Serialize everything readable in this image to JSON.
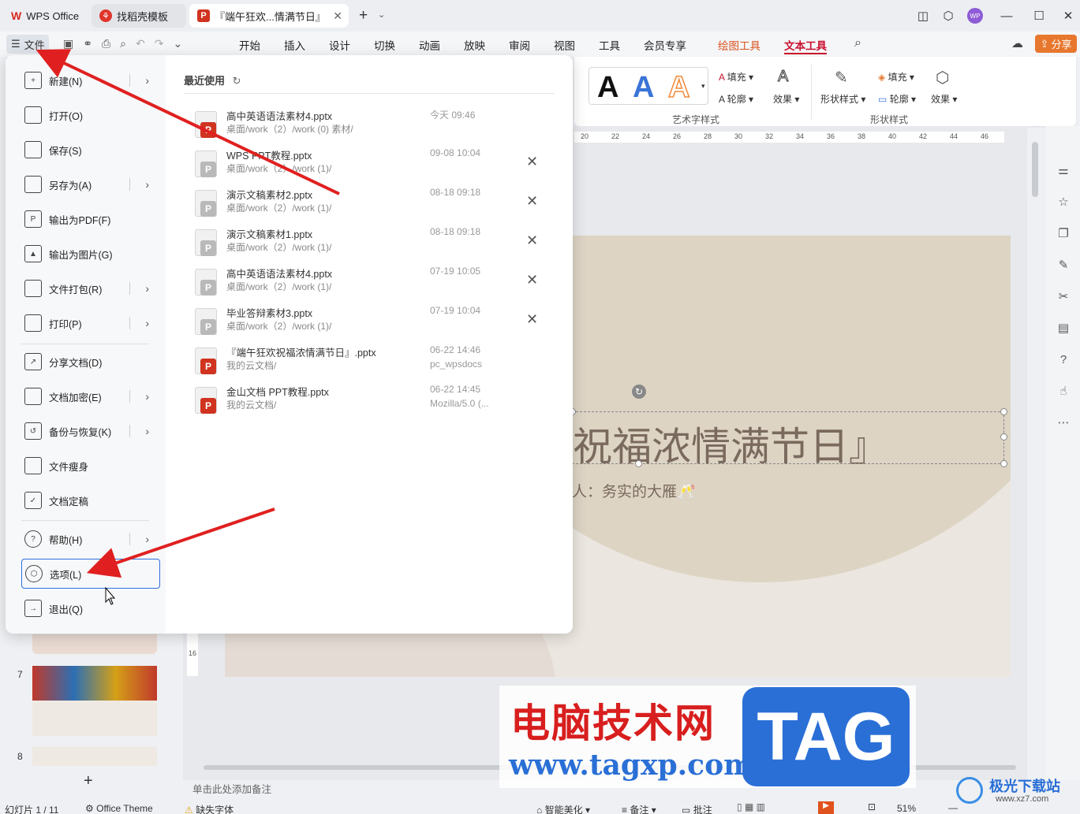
{
  "titlebar": {
    "tabs": [
      {
        "label": "WPS Office",
        "icon": "wps-logo-icon"
      },
      {
        "label": "找稻壳模板",
        "icon": "docer-icon"
      },
      {
        "label": "『端午狂欢...情满节日』",
        "icon": "ppt-icon"
      }
    ],
    "add_tab": "+",
    "avatar": "WP"
  },
  "menubar": {
    "file_label": "文件",
    "tabs": [
      "开始",
      "插入",
      "设计",
      "切换",
      "动画",
      "放映",
      "审阅",
      "视图",
      "工具",
      "会员专享",
      "绘图工具",
      "文本工具"
    ],
    "share_label": "分享"
  },
  "ribbon": {
    "fill": "填充",
    "outline": "轮廓",
    "effect": "效果",
    "shape_style": "形状样式",
    "art_group": "艺术字样式",
    "shape_group": "形状样式",
    "art_letters": [
      "A",
      "A",
      "A"
    ],
    "ruler": [
      "20",
      "22",
      "24",
      "26",
      "28",
      "30",
      "32",
      "34",
      "36",
      "38",
      "40",
      "42",
      "44",
      "46"
    ]
  },
  "file_menu": {
    "items": [
      {
        "label": "新建(N)",
        "icon": "new-file-icon",
        "arrow": true
      },
      {
        "label": "打开(O)",
        "icon": "open-folder-icon",
        "arrow": false
      },
      {
        "label": "保存(S)",
        "icon": "save-icon",
        "arrow": false
      },
      {
        "label": "另存为(A)",
        "icon": "save-as-icon",
        "arrow": true
      },
      {
        "label": "输出为PDF(F)",
        "icon": "pdf-icon",
        "arrow": false
      },
      {
        "label": "输出为图片(G)",
        "icon": "image-icon",
        "arrow": false
      },
      {
        "label": "文件打包(R)",
        "icon": "package-icon",
        "arrow": true
      },
      {
        "label": "打印(P)",
        "icon": "print-icon",
        "arrow": true
      },
      {
        "label": "分享文档(D)",
        "icon": "share-icon",
        "arrow": false
      },
      {
        "label": "文档加密(E)",
        "icon": "lock-icon",
        "arrow": true
      },
      {
        "label": "备份与恢复(K)",
        "icon": "backup-icon",
        "arrow": true
      },
      {
        "label": "文件瘦身",
        "icon": "slim-icon",
        "arrow": false
      },
      {
        "label": "文档定稿",
        "icon": "finalize-icon",
        "arrow": false
      },
      {
        "label": "帮助(H)",
        "icon": "help-icon",
        "arrow": true
      },
      {
        "label": "选项(L)",
        "icon": "settings-hex-icon",
        "arrow": false
      },
      {
        "label": "退出(Q)",
        "icon": "exit-icon",
        "arrow": false
      }
    ],
    "recent_title": "最近使用",
    "recent": [
      {
        "name": "高中英语语法素材4.pptx",
        "path": "桌面/work（2）/work (0) 素材/",
        "time": "今天  09:46",
        "time2": "",
        "closable": false,
        "cloud": false,
        "active": true
      },
      {
        "name": "WPS PPT教程.pptx",
        "path": "桌面/work（2）/work (1)/",
        "time": "09-08 10:04",
        "time2": "",
        "closable": true,
        "cloud": false,
        "active": false
      },
      {
        "name": "演示文稿素材2.pptx",
        "path": "桌面/work（2）/work (1)/",
        "time": "08-18 09:18",
        "time2": "",
        "closable": true,
        "cloud": false,
        "active": false
      },
      {
        "name": "演示文稿素材1.pptx",
        "path": "桌面/work（2）/work (1)/",
        "time": "08-18 09:18",
        "time2": "",
        "closable": true,
        "cloud": false,
        "active": false
      },
      {
        "name": "高中英语语法素材4.pptx",
        "path": "桌面/work（2）/work (1)/",
        "time": "07-19 10:05",
        "time2": "",
        "closable": true,
        "cloud": false,
        "active": false
      },
      {
        "name": "毕业答辩素材3.pptx",
        "path": "桌面/work（2）/work (1)/",
        "time": "07-19 10:04",
        "time2": "",
        "closable": true,
        "cloud": false,
        "active": false
      },
      {
        "name": "『端午狂欢祝福浓情满节日』.pptx",
        "path": "我的云文档/",
        "time": "06-22 14:46",
        "time2": "pc_wpsdocs",
        "closable": false,
        "cloud": true,
        "active": true
      },
      {
        "name": "金山文档 PPT教程.pptx",
        "path": "我的云文档/",
        "time": "06-22 14:45",
        "time2": "Mozilla/5.0 (...",
        "closable": false,
        "cloud": true,
        "active": true
      }
    ]
  },
  "slide": {
    "title": "祝福浓情满节日』",
    "subtitle": "人：务实的大雁🥂"
  },
  "thumbs": {
    "num7": "7",
    "num8": "8",
    "add": "+"
  },
  "notes_placeholder": "单击此处添加备注",
  "status": {
    "slide": "幻灯片 1 / 11",
    "theme": "Office Theme",
    "missing_font": "缺失字体",
    "beautify": "智能美化",
    "notes": "备注",
    "comments": "批注",
    "zoom": "51%"
  },
  "watermark": {
    "cn": "电脑技术网",
    "url": "www.tagxp.com",
    "tag": "TAG",
    "site": "极光下载站",
    "site_url": "www.xz7.com"
  },
  "colors": {
    "accent": "#d9531e",
    "ppt_red": "#d0331f",
    "selection": "#2f6fe0"
  }
}
